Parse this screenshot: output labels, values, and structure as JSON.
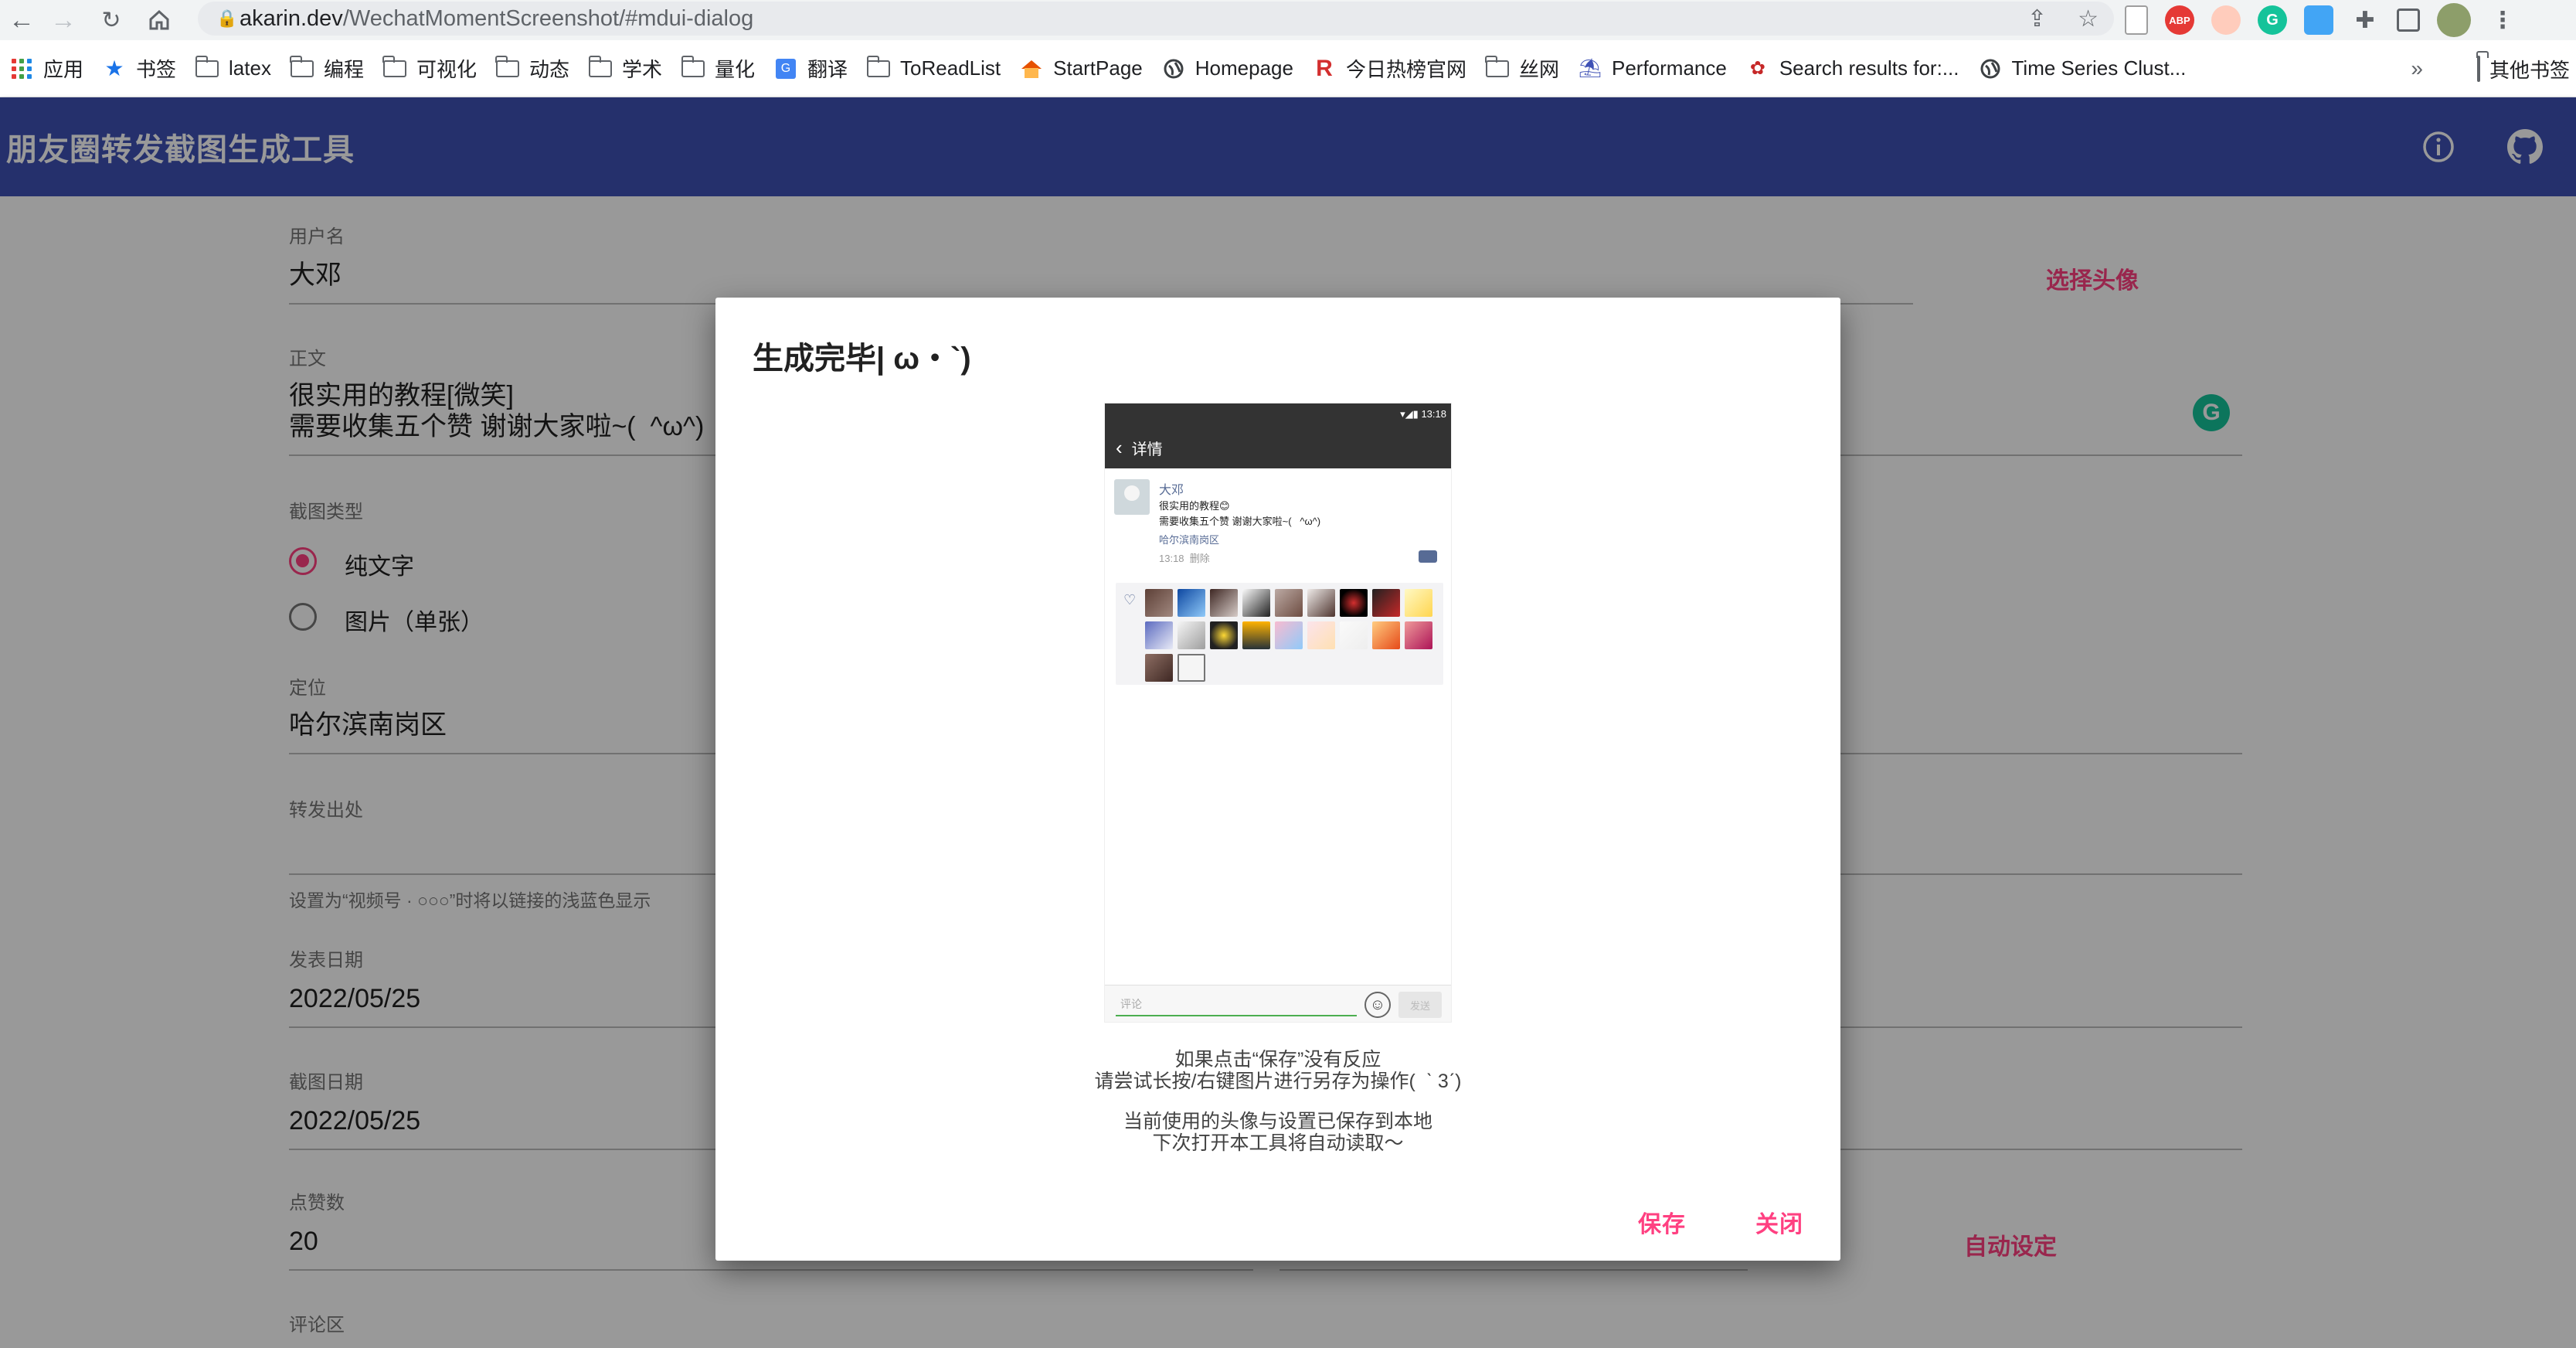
{
  "browser": {
    "url_host": "akarin.dev",
    "url_path": "/WechatMomentScreenshot/#mdui-dialog",
    "extensions": [
      "ABP"
    ],
    "bookmarks": [
      {
        "label": "应用",
        "icon": "apps-grid"
      },
      {
        "label": "书签",
        "icon": "star"
      },
      {
        "label": "latex",
        "icon": "folder"
      },
      {
        "label": "编程",
        "icon": "folder"
      },
      {
        "label": "可视化",
        "icon": "folder"
      },
      {
        "label": "动态",
        "icon": "folder"
      },
      {
        "label": "学术",
        "icon": "folder"
      },
      {
        "label": "量化",
        "icon": "folder"
      },
      {
        "label": "翻译",
        "icon": "translate"
      },
      {
        "label": "ToReadList",
        "icon": "folder"
      },
      {
        "label": "StartPage",
        "icon": "house"
      },
      {
        "label": "Homepage",
        "icon": "globe"
      },
      {
        "label": "今日热榜官网",
        "icon": "R"
      },
      {
        "label": "丝网",
        "icon": "folder"
      },
      {
        "label": "Performance",
        "icon": "bell"
      },
      {
        "label": "Search results for:...",
        "icon": "emblem"
      },
      {
        "label": "Time Series Clust...",
        "icon": "globe"
      }
    ],
    "overflow": "»",
    "other_bookmarks": "其他书签"
  },
  "app": {
    "title": "朋友圈转发截图生成工具",
    "form": {
      "username_label": "用户名",
      "username": "大邓",
      "avatar_button": "选择头像",
      "body_label": "正文",
      "body": "很实用的教程[微笑]\n需要收集五个赞 谢谢大家啦~(  ^ω^)",
      "type_label": "截图类型",
      "type_options": [
        "纯文字",
        "图片（单张）"
      ],
      "location_label": "定位",
      "location": "哈尔滨南岗区",
      "source_label": "转发出处",
      "source": "",
      "source_help": "设置为“视频号 · ○○○”时将以链接的浅蓝色显示",
      "post_date_label": "发表日期",
      "post_date": "2022/05/25",
      "shot_date_label": "截图日期",
      "shot_date": "2022/05/25",
      "likes_label": "点赞数",
      "likes": "20",
      "auto_button": "自动设定",
      "comments_label": "评论区"
    }
  },
  "dialog": {
    "title": "生成完毕| ω・`)",
    "preview": {
      "status_time": "13:18",
      "nav_title": "详情",
      "name": "大邓",
      "line1": "很实用的教程😊",
      "line2": "需要收集五个赞 谢谢大家啦~(   ^ω^)",
      "location": "哈尔滨南岗区",
      "time": "13:18  删除",
      "comment_placeholder": "评论",
      "send": "发送"
    },
    "note1": "如果点击“保存”没有反应\n请尝试长按/右键图片进行另存为操作(  ˋ 3ˊ)",
    "note2": "当前使用的头像与设置已保存到本地\n下次打开本工具将自动读取～",
    "save": "保存",
    "close": "关闭"
  },
  "colors": {
    "appbar": "#3f51b5",
    "accent": "#ff4081",
    "link": "#576b95"
  }
}
